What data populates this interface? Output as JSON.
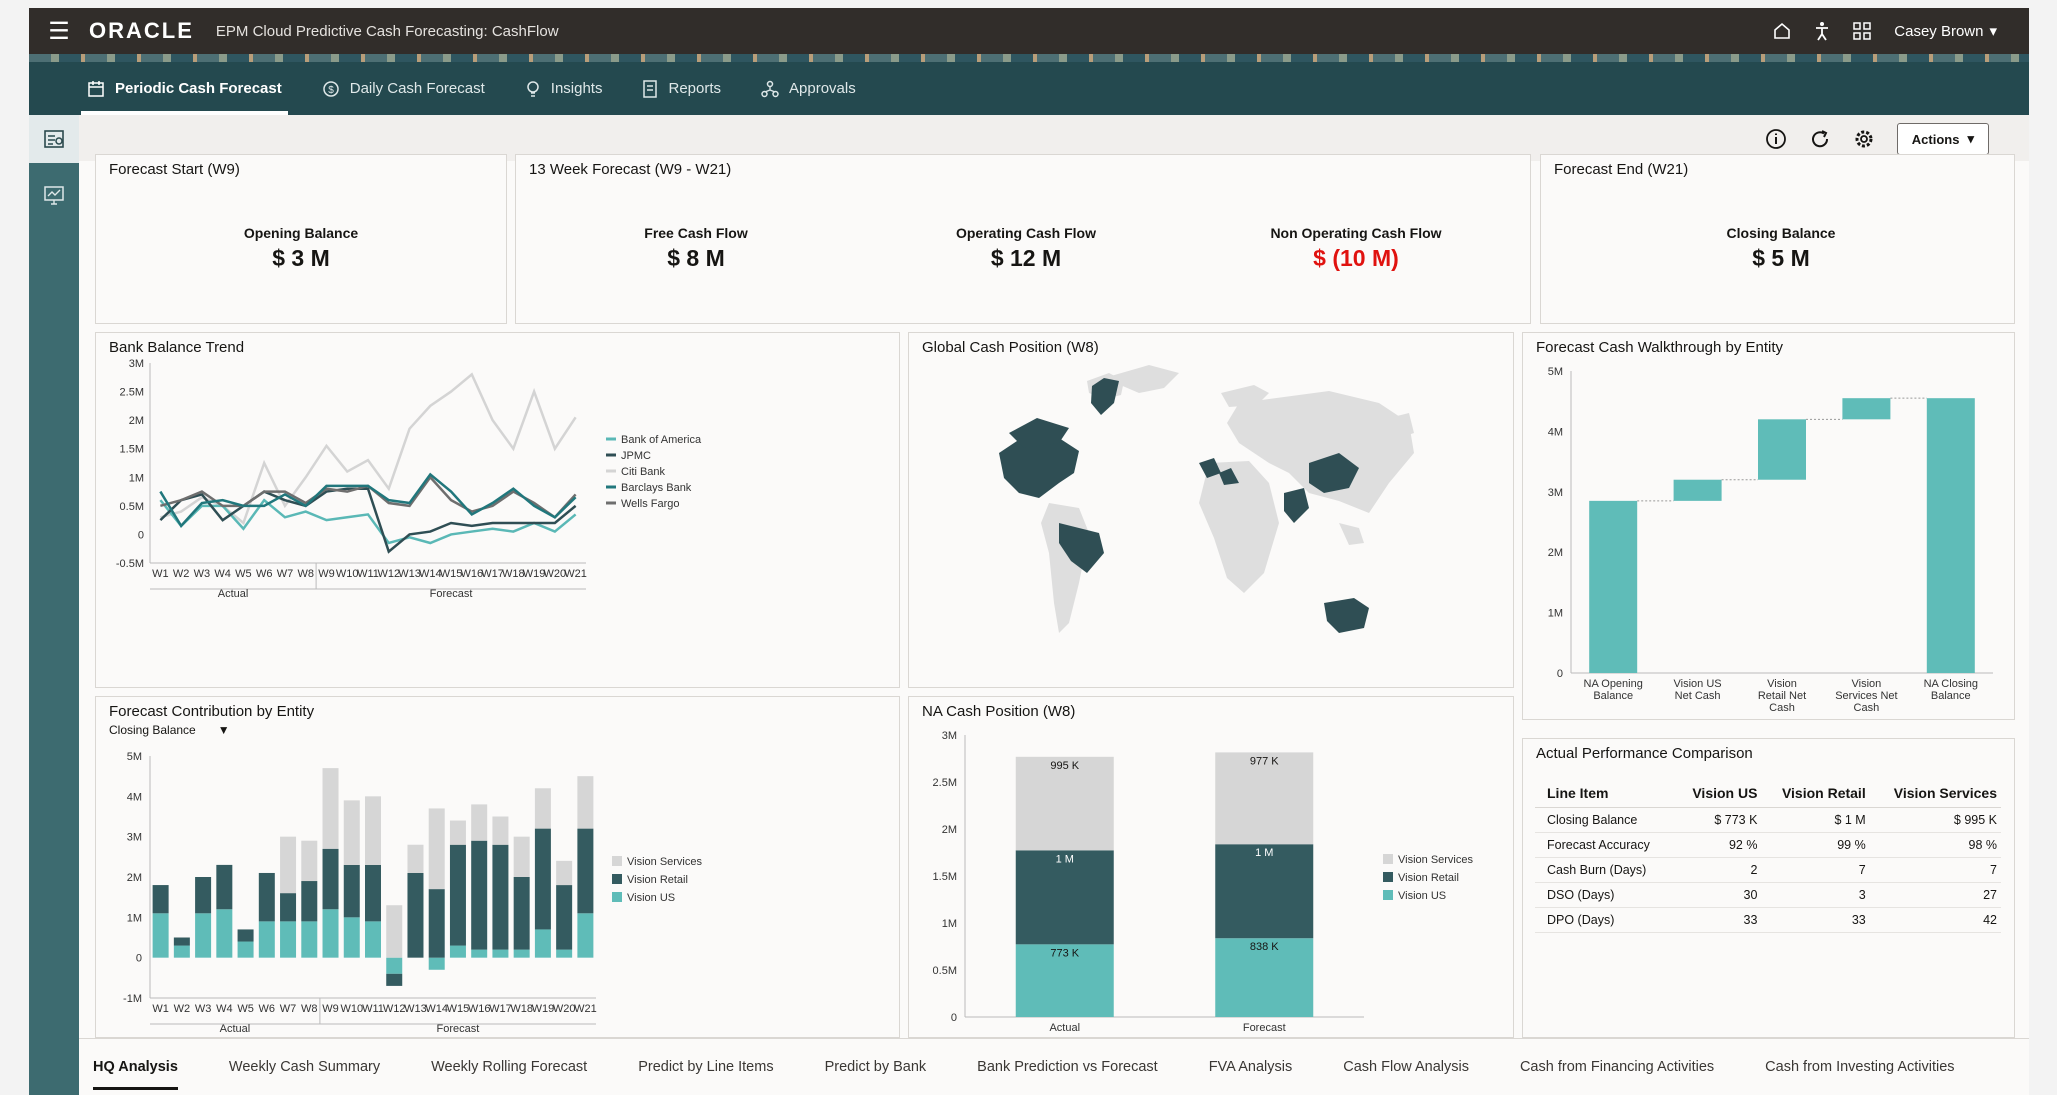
{
  "header": {
    "logo": "ORACLE",
    "app_title": "EPM Cloud Predictive Cash Forecasting:  CashFlow",
    "user": "Casey Brown"
  },
  "nav": {
    "tabs": [
      {
        "label": "Periodic Cash Forecast",
        "icon": "calendar-icon"
      },
      {
        "label": "Daily Cash Forecast",
        "icon": "coin-icon"
      },
      {
        "label": "Insights",
        "icon": "lightbulb-icon"
      },
      {
        "label": "Reports",
        "icon": "report-icon"
      },
      {
        "label": "Approvals",
        "icon": "approvals-icon"
      }
    ]
  },
  "toolbar": {
    "actions_label": "Actions"
  },
  "kpis": {
    "start": {
      "title": "Forecast Start (W9)",
      "label": "Opening Balance",
      "value": "$ 3 M"
    },
    "week13": {
      "title": "13 Week Forecast (W9 - W21)",
      "items": [
        {
          "label": "Free Cash Flow",
          "value": "$ 8 M"
        },
        {
          "label": "Operating Cash Flow",
          "value": "$ 12 M"
        },
        {
          "label": "Non Operating Cash Flow",
          "value": "$ (10 M)"
        }
      ]
    },
    "end": {
      "title": "Forecast End (W21)",
      "label": "Closing Balance",
      "value": "$ 5 M"
    }
  },
  "panels": {
    "bank_trend": "Bank Balance Trend",
    "global_cash": "Global Cash Position (W8)",
    "walkthrough": "Forecast Cash Walkthrough by Entity",
    "contribution": "Forecast Contribution by Entity",
    "contribution_dropdown": "Closing Balance",
    "na_cash": "NA Cash Position (W8)",
    "performance": "Actual Performance Comparison"
  },
  "colors": {
    "bank_of_america": "#5ab8b6",
    "jpmc": "#2f4e54",
    "citi": "#d4d4d4",
    "barclays": "#21777c",
    "wells": "#6e6e6e",
    "vision_services": "#d6d6d6",
    "vision_retail": "#345b60",
    "vision_us": "#5fbcb8",
    "negative": "#e0120f"
  },
  "chart_data": [
    {
      "type": "line",
      "title": "Bank Balance Trend",
      "categories": [
        "W1",
        "W2",
        "W3",
        "W4",
        "W5",
        "W6",
        "W7",
        "W8",
        "W9",
        "W10",
        "W11",
        "W12",
        "W13",
        "W14",
        "W15",
        "W16",
        "W17",
        "W18",
        "W19",
        "W20",
        "W21"
      ],
      "groups": [
        {
          "label": "Actual",
          "from": "W1",
          "to": "W8"
        },
        {
          "label": "Forecast",
          "from": "W9",
          "to": "W21"
        }
      ],
      "ylim": [
        -0.5,
        3
      ],
      "yticks": [
        "3M",
        "2.5M",
        "2M",
        "1.5M",
        "1M",
        "0.5M",
        "0",
        "-0.5M"
      ],
      "legend_position": "right",
      "series": [
        {
          "name": "Bank of America",
          "values": [
            0.6,
            0.15,
            0.5,
            0.5,
            0.1,
            0.6,
            0.3,
            0.4,
            0.25,
            0.3,
            0.35,
            -0.15,
            -0.05,
            -0.15,
            0.0,
            0.05,
            0.1,
            0.05,
            0.2,
            0.05,
            0.35
          ]
        },
        {
          "name": "JPMC",
          "values": [
            0.25,
            0.6,
            0.7,
            0.25,
            0.5,
            0.75,
            0.6,
            0.5,
            0.75,
            0.8,
            0.8,
            -0.3,
            0.0,
            0.05,
            0.2,
            0.15,
            0.2,
            0.2,
            0.2,
            0.2,
            0.5
          ]
        },
        {
          "name": "Citi Bank",
          "values": [
            0.3,
            0.4,
            0.65,
            0.5,
            0.2,
            1.25,
            0.5,
            1.0,
            1.55,
            1.1,
            1.3,
            0.8,
            1.85,
            2.25,
            2.5,
            2.8,
            2.0,
            1.5,
            2.5,
            1.5,
            2.05
          ]
        },
        {
          "name": "Barclays Bank",
          "values": [
            0.75,
            0.15,
            0.55,
            0.6,
            0.5,
            0.5,
            0.7,
            0.5,
            0.85,
            0.85,
            0.85,
            0.6,
            0.55,
            1.05,
            0.75,
            0.35,
            0.55,
            0.8,
            0.5,
            0.3,
            0.65
          ]
        },
        {
          "name": "Wells Fargo",
          "values": [
            0.5,
            0.6,
            0.75,
            0.5,
            0.5,
            0.75,
            0.75,
            0.55,
            0.8,
            0.75,
            0.85,
            0.55,
            0.5,
            1.0,
            0.6,
            0.4,
            0.5,
            0.75,
            0.55,
            0.3,
            0.7
          ]
        }
      ]
    },
    {
      "type": "bar",
      "title": "Forecast Cash Walkthrough by Entity",
      "categories": [
        "NA Opening Balance",
        "Vision US Net Cash",
        "Vision Retail Net Cash",
        "Vision Services Net Cash",
        "NA Closing Balance"
      ],
      "waterfall": [
        [
          0,
          2.85
        ],
        [
          2.85,
          3.2
        ],
        [
          3.2,
          4.2
        ],
        [
          4.2,
          4.55
        ],
        [
          0,
          4.55
        ]
      ],
      "ylim": [
        0,
        5
      ],
      "yticks": [
        "5M",
        "4M",
        "3M",
        "2M",
        "1M",
        "0"
      ]
    },
    {
      "type": "bar",
      "title": "Forecast Contribution by Entity",
      "stacked": true,
      "categories": [
        "W1",
        "W2",
        "W3",
        "W4",
        "W5",
        "W6",
        "W7",
        "W8",
        "W9",
        "W10",
        "W11",
        "W12",
        "W13",
        "W14",
        "W15",
        "W16",
        "W17",
        "W18",
        "W19",
        "W20",
        "W21"
      ],
      "groups": [
        {
          "label": "Actual",
          "from": "W1",
          "to": "W8"
        },
        {
          "label": "Forecast",
          "from": "W9",
          "to": "W21"
        }
      ],
      "ylim": [
        -1,
        5
      ],
      "yticks": [
        "5M",
        "4M",
        "3M",
        "2M",
        "1M",
        "0",
        "-1M"
      ],
      "legend_position": "right",
      "series": [
        {
          "name": "Vision US",
          "values": [
            1.1,
            0.3,
            1.1,
            1.2,
            0.4,
            0.9,
            0.9,
            0.9,
            1.2,
            1.0,
            0.9,
            -0.4,
            0.0,
            -0.3,
            0.3,
            0.2,
            0.2,
            0.2,
            0.7,
            0.2,
            1.1
          ]
        },
        {
          "name": "Vision Retail",
          "values": [
            0.7,
            0.2,
            0.9,
            1.1,
            0.3,
            1.2,
            0.7,
            1.0,
            1.5,
            1.3,
            1.4,
            -0.3,
            2.1,
            1.7,
            2.5,
            2.7,
            2.6,
            1.8,
            2.5,
            1.6,
            2.1
          ]
        },
        {
          "name": "Vision Services",
          "values": [
            0,
            0,
            0,
            0,
            0,
            0,
            1.4,
            1.0,
            2.0,
            1.6,
            1.7,
            1.3,
            0.7,
            2.0,
            0.6,
            0.9,
            0.7,
            1.0,
            1.0,
            0.6,
            1.3
          ]
        }
      ]
    },
    {
      "type": "bar",
      "title": "NA Cash Position (W8)",
      "stacked": true,
      "categories": [
        "Actual",
        "Forecast"
      ],
      "ylim": [
        0,
        3
      ],
      "yticks": [
        "3M",
        "2.5M",
        "2M",
        "1.5M",
        "1M",
        "0.5M",
        "0"
      ],
      "legend_position": "right",
      "series": [
        {
          "name": "Vision US",
          "values": [
            0.773,
            0.838
          ],
          "labels": [
            "773 K",
            "838 K"
          ]
        },
        {
          "name": "Vision Retail",
          "values": [
            1.0,
            1.0
          ],
          "labels": [
            "1 M",
            "1 M"
          ]
        },
        {
          "name": "Vision Services",
          "values": [
            0.995,
            0.977
          ],
          "labels": [
            "995 K",
            "977 K"
          ]
        }
      ]
    },
    {
      "type": "table",
      "title": "Actual Performance Comparison",
      "columns": [
        "Line Item",
        "Vision US",
        "Vision Retail",
        "Vision Services"
      ],
      "rows": [
        [
          "Closing Balance",
          "$ 773 K",
          "$ 1 M",
          "$ 995 K"
        ],
        [
          "Forecast Accuracy",
          "92 %",
          "99 %",
          "98 %"
        ],
        [
          "Cash Burn (Days)",
          "2",
          "7",
          "7"
        ],
        [
          "DSO (Days)",
          "30",
          "3",
          "27"
        ],
        [
          "DPO (Days)",
          "33",
          "33",
          "42"
        ]
      ]
    }
  ],
  "map": {
    "highlighted_countries": "North America, Brazil, Western Europe, India, China, Australia"
  },
  "bottom_tabs": [
    "HQ Analysis",
    "Weekly Cash Summary",
    "Weekly Rolling Forecast",
    "Predict by Line Items",
    "Predict by Bank",
    "Bank Prediction vs Forecast",
    "FVA Analysis",
    "Cash Flow Analysis",
    "Cash from Financing Activities",
    "Cash from Investing Activities"
  ]
}
